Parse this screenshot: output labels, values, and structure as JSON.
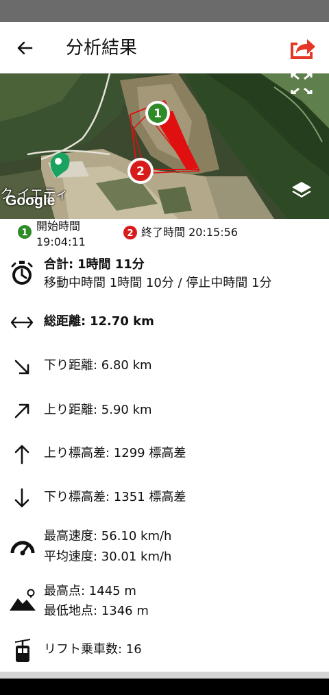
{
  "header": {
    "title": "分析結果"
  },
  "map": {
    "place_label": "ク イエティ",
    "attribution": "Google",
    "start_marker": "1",
    "end_marker": "2",
    "colors": {
      "track": "#e01010",
      "start": "#2e8b28",
      "end": "#d81c1c"
    }
  },
  "legend": {
    "start_label": "開始時間",
    "start_time": "19:04:11",
    "end_text": "終了時間 20:15:56"
  },
  "stats": {
    "total_label": "合計:",
    "total_value": "1時間 11分",
    "moving_text": "移動中時間 1時間 10分 / 停止中時間 1分",
    "distance_label": "総距離:",
    "distance_value": "12.70 km",
    "down_distance": "下り距離: 6.80 km",
    "up_distance": "上り距離: 5.90 km",
    "ascent": "上り標高差: 1299 標高差",
    "descent": "下り標高差: 1351 標高差",
    "max_speed": "最高速度: 56.10 km/h",
    "avg_speed": "平均速度: 30.01 km/h",
    "max_alt": "最高点: 1445 m",
    "min_alt": "最低地点: 1346 m",
    "lifts": "リフト乗車数: 16"
  }
}
